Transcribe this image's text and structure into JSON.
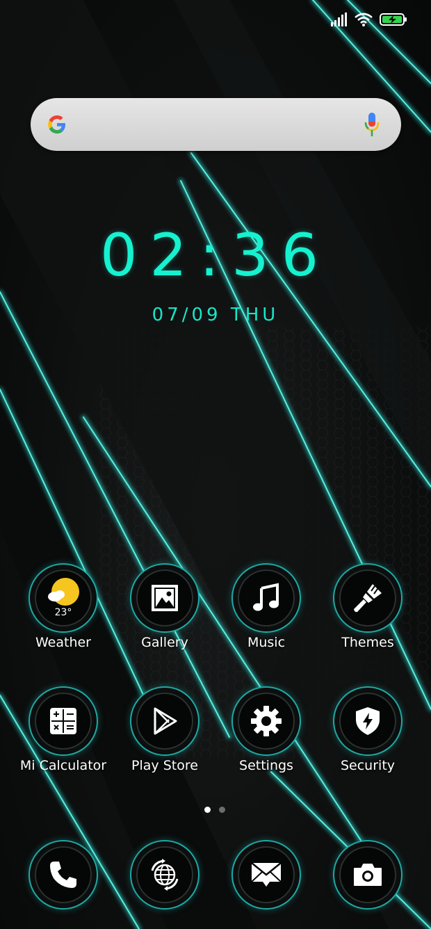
{
  "status_bar": {
    "signal_icon": "signal-bars-icon",
    "wifi_icon": "wifi-icon",
    "battery_icon": "battery-charging-icon"
  },
  "search": {
    "logo_icon": "google-g-icon",
    "mic_icon": "microphone-icon"
  },
  "clock": {
    "time": "02:36",
    "date": "07/09 THU"
  },
  "apps": [
    {
      "label": "Weather",
      "icon": "weather-icon",
      "temp": "23°"
    },
    {
      "label": "Gallery",
      "icon": "gallery-icon"
    },
    {
      "label": "Music",
      "icon": "music-note-icon"
    },
    {
      "label": "Themes",
      "icon": "paintbrush-icon"
    },
    {
      "label": "Mi Calculator",
      "icon": "calculator-icon"
    },
    {
      "label": "Play Store",
      "icon": "play-store-icon"
    },
    {
      "label": "Settings",
      "icon": "gear-icon"
    },
    {
      "label": "Security",
      "icon": "shield-icon"
    }
  ],
  "page_indicator": {
    "pages": 2,
    "current": 1
  },
  "dock": [
    {
      "icon": "phone-icon"
    },
    {
      "icon": "browser-globe-icon"
    },
    {
      "icon": "messages-icon"
    },
    {
      "icon": "camera-icon"
    }
  ],
  "colors": {
    "accent": "#16f2cf",
    "glow": "#1ea9a4"
  }
}
